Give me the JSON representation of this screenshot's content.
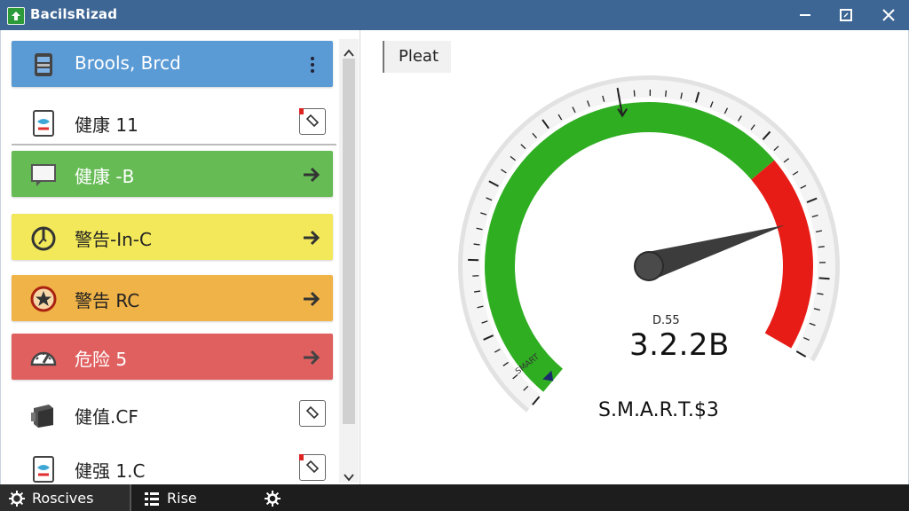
{
  "window": {
    "title": "BacilsRizad"
  },
  "sidebar": {
    "items": [
      {
        "label": "Brools, Brcd",
        "color": "#5b9bd5",
        "text_color": "#ffffff",
        "icon": "storage-drive-icon",
        "right": "more-vertical-icon"
      },
      {
        "label": "健康 11",
        "color": "#ffffff",
        "text_color": "#222222",
        "icon": "disk-health-icon",
        "right": "edit-button"
      },
      {
        "label": "健康 -B",
        "color": "#66bb55",
        "text_color": "#ffffff",
        "icon": "chat-bubble-icon",
        "right": "arrow-right-icon"
      },
      {
        "label": "警告-In-C",
        "color": "#f2e85a",
        "text_color": "#222222",
        "icon": "power-icon",
        "right": "arrow-right-icon"
      },
      {
        "label": "警告 RC",
        "color": "#f0b347",
        "text_color": "#222222",
        "icon": "star-badge-icon",
        "right": "arrow-right-icon"
      },
      {
        "label": "危险 5",
        "color": "#e06060",
        "text_color": "#ffffff",
        "icon": "speedometer-icon",
        "right": "arrow-right-icon"
      },
      {
        "label": "健值.CF",
        "color": "#ffffff",
        "text_color": "#222222",
        "icon": "drive-block-icon",
        "right": "edit-button"
      },
      {
        "label": "健强 1.C",
        "color": "#ffffff",
        "text_color": "#222222",
        "icon": "disk-health-icon",
        "right": "edit-button"
      }
    ]
  },
  "main": {
    "tab": "Pleat",
    "gauge": {
      "small_label": "D.55",
      "value_text": "3.2.2B",
      "caption": "S.M.A.R.T.$3",
      "min_label": "SMART",
      "needle_fraction": 0.82,
      "top_marker_fraction": 0.5,
      "colors": {
        "good": "#2fae22",
        "bad": "#e81c16"
      }
    }
  },
  "taskbar": {
    "items": [
      {
        "label": "Roscives",
        "icon": "gear-icon"
      },
      {
        "label": "Rise",
        "icon": "list-icon"
      },
      {
        "label": "",
        "icon": "settings-icon"
      }
    ]
  }
}
